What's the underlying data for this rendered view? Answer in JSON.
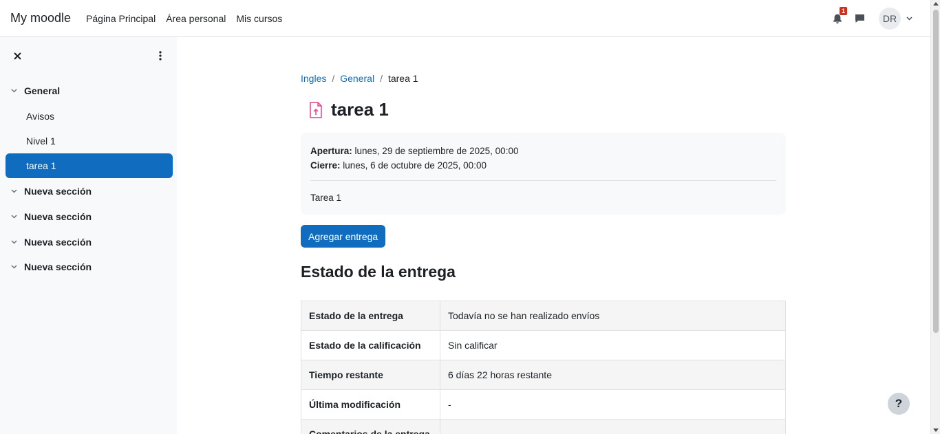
{
  "navbar": {
    "brand": "My moodle",
    "links": [
      "Página Principal",
      "Área personal",
      "Mis cursos"
    ],
    "notification_count": "1",
    "avatar_initials": "DR",
    "icons": [
      "bell-icon",
      "chat-icon",
      "chevron-down-icon"
    ]
  },
  "drawer": {
    "sections": [
      {
        "label": "General",
        "items": [
          "Avisos",
          "Nivel 1",
          "tarea 1"
        ]
      },
      {
        "label": "Nueva sección"
      },
      {
        "label": "Nueva sección"
      },
      {
        "label": "Nueva sección"
      },
      {
        "label": "Nueva sección"
      }
    ],
    "active_item": "tarea 1"
  },
  "breadcrumb": [
    "Ingles",
    "General",
    "tarea 1"
  ],
  "page": {
    "title": "tarea 1",
    "opening_label": "Apertura:",
    "opening_value": "lunes, 29 de septiembre de 2025, 00:00",
    "closing_label": "Cierre:",
    "closing_value": "lunes, 6 de octubre de 2025, 00:00",
    "description": "Tarea 1",
    "submit_button": "Agregar entrega",
    "status_heading": "Estado de la entrega"
  },
  "status_table": [
    {
      "label": "Estado de la entrega",
      "value": "Todavía no se han realizado envíos"
    },
    {
      "label": "Estado de la calificación",
      "value": "Sin calificar"
    },
    {
      "label": "Tiempo restante",
      "value": "6 días 22 horas restante"
    },
    {
      "label": "Última modificación",
      "value": "-"
    },
    {
      "label": "Comentarios de la entrega",
      "value": ""
    }
  ],
  "help_button": "?",
  "colors": {
    "primary": "#0f6cbf",
    "assignment_icon": "#e83e8c",
    "badge": "#ca3120"
  }
}
